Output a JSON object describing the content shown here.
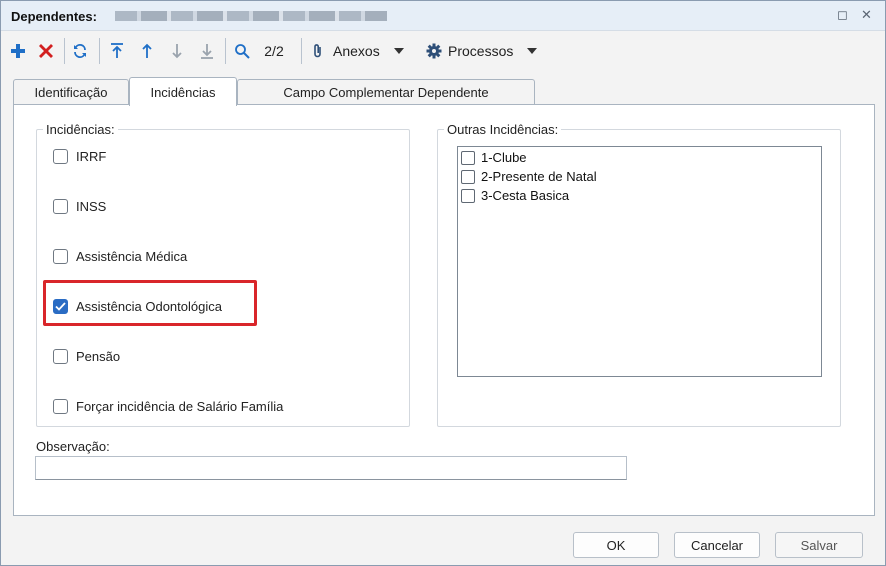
{
  "window": {
    "title_label": "Dependentes:",
    "minimize_glyph": "◻",
    "close_glyph": "✕"
  },
  "toolbar": {
    "counter": "2/2",
    "anexos_label": "Anexos",
    "processos_label": "Processos",
    "icons": [
      "add-icon",
      "delete-icon",
      "refresh-icon",
      "first-record-icon",
      "previous-record-icon",
      "next-record-icon",
      "last-record-icon",
      "search-icon",
      "paperclip-icon",
      "gear-icon",
      "caret-down-icon"
    ]
  },
  "tabs": [
    {
      "label": "Identificação",
      "active": false
    },
    {
      "label": "Incidências",
      "active": true
    },
    {
      "label": "Campo Complementar Dependente",
      "active": false
    }
  ],
  "incidencias": {
    "legend": "Incidências:",
    "items": [
      {
        "label": "IRRF",
        "checked": false
      },
      {
        "label": "INSS",
        "checked": false
      },
      {
        "label": "Assistência Médica",
        "checked": false
      },
      {
        "label": "Assistência Odontológica",
        "checked": true
      },
      {
        "label": "Pensão",
        "checked": false
      },
      {
        "label": "Forçar incidência de Salário Família",
        "checked": false
      }
    ]
  },
  "outras": {
    "legend": "Outras Incidências:",
    "items": [
      {
        "label": "1-Clube",
        "checked": false
      },
      {
        "label": "2-Presente de Natal",
        "checked": false
      },
      {
        "label": "3-Cesta Basica",
        "checked": false
      }
    ]
  },
  "observacao": {
    "label": "Observação:",
    "value": ""
  },
  "buttons": {
    "ok": "OK",
    "cancelar": "Cancelar",
    "salvar": "Salvar"
  },
  "colors": {
    "accent_blue": "#2a6cc4",
    "delete_red": "#d21f1f",
    "highlight_red": "#d9262a"
  }
}
